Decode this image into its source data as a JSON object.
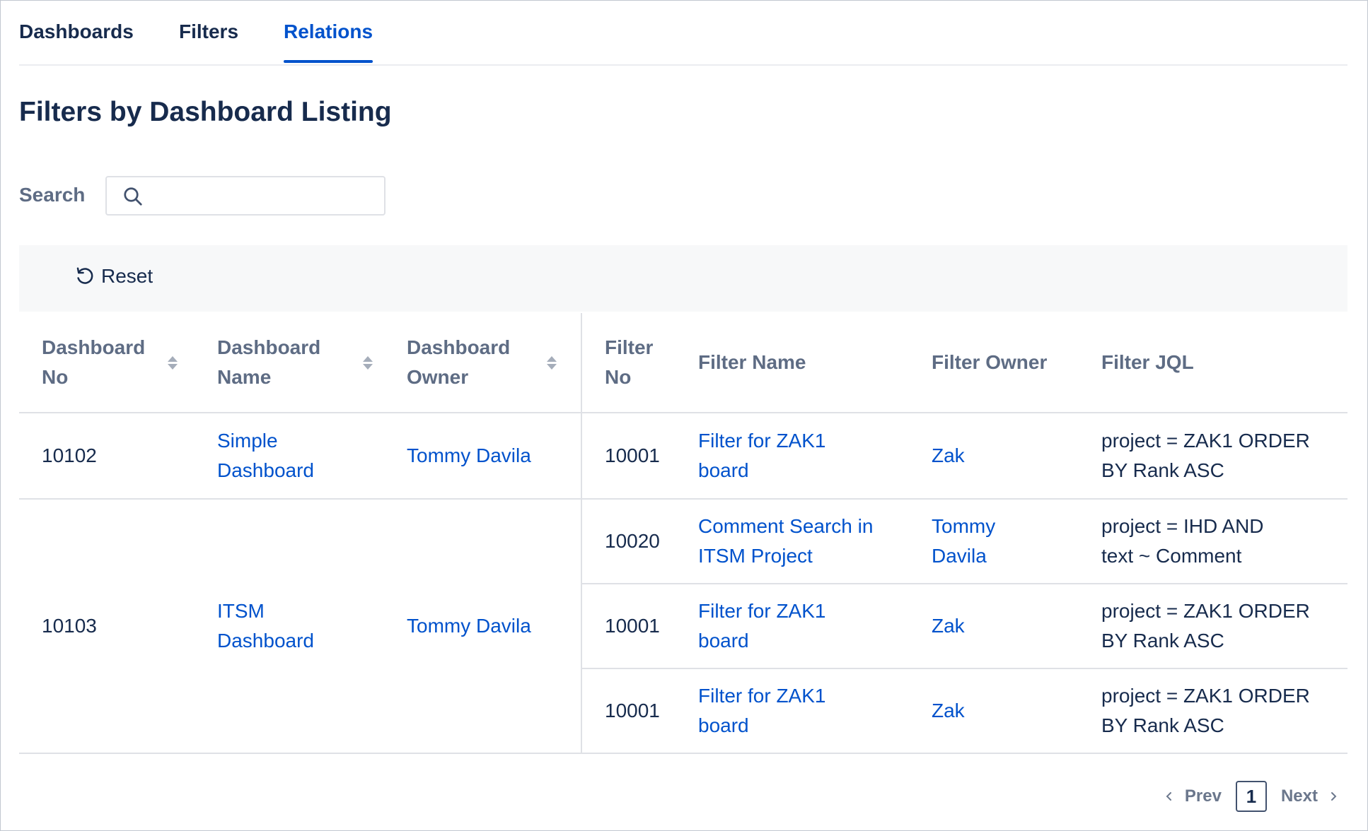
{
  "tabs": [
    {
      "label": "Dashboards",
      "active": false
    },
    {
      "label": "Filters",
      "active": false
    },
    {
      "label": "Relations",
      "active": true
    }
  ],
  "page_title": "Filters by Dashboard Listing",
  "search": {
    "label": "Search",
    "value": "",
    "placeholder": ""
  },
  "reset_label": "Reset",
  "table": {
    "headers": {
      "dashboard_no": "Dashboard No",
      "dashboard_name": "Dashboard Name",
      "dashboard_owner": "Dashboard Owner",
      "filter_no": "Filter No",
      "filter_name": "Filter Name",
      "filter_owner": "Filter Owner",
      "filter_jql": "Filter JQL"
    },
    "dashboards": [
      {
        "no": "10102",
        "name": "Simple Dashboard",
        "owner": "Tommy Davila",
        "filters": [
          {
            "no": "10001",
            "name": "Filter for ZAK1 board",
            "owner": "Zak",
            "jql": "project = ZAK1 ORDER BY Rank ASC"
          }
        ]
      },
      {
        "no": "10103",
        "name": "ITSM Dashboard",
        "owner": "Tommy Davila",
        "filters": [
          {
            "no": "10020",
            "name": "Comment Search in ITSM Project",
            "owner": "Tommy Davila",
            "jql": "project = IHD AND text ~ Comment"
          },
          {
            "no": "10001",
            "name": "Filter for ZAK1 board",
            "owner": "Zak",
            "jql": "project = ZAK1 ORDER BY Rank ASC"
          },
          {
            "no": "10001",
            "name": "Filter for ZAK1 board",
            "owner": "Zak",
            "jql": "project = ZAK1 ORDER BY Rank ASC"
          }
        ]
      }
    ]
  },
  "pagination": {
    "prev_label": "Prev",
    "current_page": "1",
    "next_label": "Next"
  },
  "colors": {
    "accent": "#0052cc",
    "text": "#172b4d",
    "muted": "#5e6c84",
    "border": "#dfe1e6"
  }
}
